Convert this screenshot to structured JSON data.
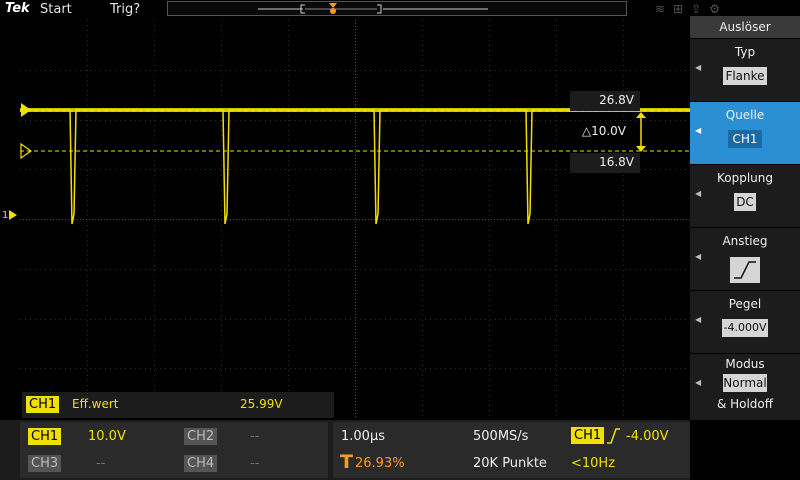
{
  "topbar": {
    "logo": "Tek",
    "start_label": "Start",
    "trig_label": "Trig?"
  },
  "colors": {
    "ch1": "#f0e000",
    "trigger": "#ff9a1f",
    "active_menu": "#2b8fd3"
  },
  "icons": [
    "wifi-icon",
    "lan-icon",
    "export-icon",
    "settings-icon"
  ],
  "waveform": {
    "ch1_marker": "1",
    "cursor_upper": "26.8V",
    "cursor_delta": "△10.0V",
    "cursor_lower": "16.8V"
  },
  "measurement": {
    "channel": "CH1",
    "name": "Eff.wert",
    "value": "25.99V"
  },
  "channels": {
    "ch1": {
      "label": "CH1",
      "value": "10.0V"
    },
    "ch2": {
      "label": "CH2",
      "value": "--"
    },
    "ch3": {
      "label": "CH3",
      "value": "--"
    },
    "ch4": {
      "label": "CH4",
      "value": "--"
    }
  },
  "horizontal": {
    "timebase": "1.00µs",
    "sample_rate": "500MS/s",
    "trigger_position": "26.93%",
    "record_length": "20K Punkte",
    "trigger_source": "CH1",
    "trigger_level": "-4.00V",
    "trigger_freq": "<10Hz"
  },
  "menu": {
    "title": "Auslöser",
    "items": [
      {
        "label": "Typ",
        "value": "Flanke"
      },
      {
        "label": "Quelle",
        "value": "CH1"
      },
      {
        "label": "Kopplung",
        "value": "DC"
      },
      {
        "label": "Anstieg",
        "value": ""
      },
      {
        "label": "Pegel",
        "value": "-4.000V"
      },
      {
        "label": "Modus",
        "value": "Normal",
        "value2": "& Holdoff"
      }
    ]
  }
}
